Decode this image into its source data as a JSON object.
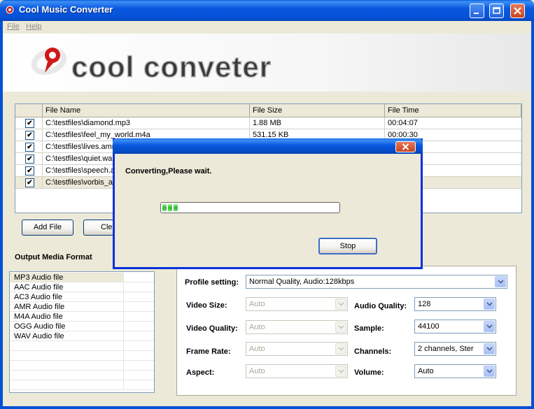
{
  "window": {
    "title": "Cool Music Converter"
  },
  "menu": {
    "items": [
      "File",
      "Help"
    ]
  },
  "banner": {
    "logo_text": "cool conveter"
  },
  "file_table": {
    "columns": [
      "File Name",
      "File Size",
      "File Time"
    ],
    "rows": [
      {
        "checked": true,
        "name": "C:\\testfiles\\diamond.mp3",
        "size": "1.88 MB",
        "time": "00:04:07"
      },
      {
        "checked": true,
        "name": "C:\\testfiles\\feel_my_world.m4a",
        "size": "531.15 KB",
        "time": "00:00:30"
      },
      {
        "checked": true,
        "name": "C:\\testfiles\\lives.amr",
        "size": "",
        "time": ""
      },
      {
        "checked": true,
        "name": "C:\\testfiles\\quiet.wa",
        "size": "",
        "time": ""
      },
      {
        "checked": true,
        "name": "C:\\testfiles\\speech.a",
        "size": "",
        "time": ""
      },
      {
        "checked": true,
        "name": "C:\\testfiles\\vorbis_a",
        "size": "",
        "time": ""
      }
    ]
  },
  "buttons": {
    "add_file": "Add File",
    "clear": "Cle"
  },
  "output_format": {
    "label": "Output Media Format",
    "items": [
      "MP3 Audio file",
      "AAC Audio file",
      "AC3 Audio file",
      "AMR Audio file",
      "M4A Audio file",
      "OGG Audio file",
      "WAV Audio file"
    ],
    "selected": "MP3 Audio file"
  },
  "settings": {
    "profile_label": "Profile setting:",
    "profile_value": "Normal Quality, Audio:128kbps",
    "video_size_label": "Video Size:",
    "video_size_value": "Auto",
    "video_quality_label": "Video Quality:",
    "video_quality_value": "Auto",
    "frame_rate_label": "Frame Rate:",
    "frame_rate_value": "Auto",
    "aspect_label": "Aspect:",
    "aspect_value": "Auto",
    "audio_quality_label": "Audio Quality:",
    "audio_quality_value": "128",
    "sample_label": "Sample:",
    "sample_value": "44100",
    "channels_label": "Channels:",
    "channels_value": "2 channels, Ster",
    "volume_label": "Volume:",
    "volume_value": "Auto"
  },
  "dialog": {
    "message": "Converting,Please wait.",
    "stop_button": "Stop",
    "progress": 0.1
  },
  "colors": {
    "titlebar": "#0858e0",
    "window_bg": "#ece9d8",
    "logo_red": "#d01818",
    "progress_green": "#2fb92f"
  }
}
